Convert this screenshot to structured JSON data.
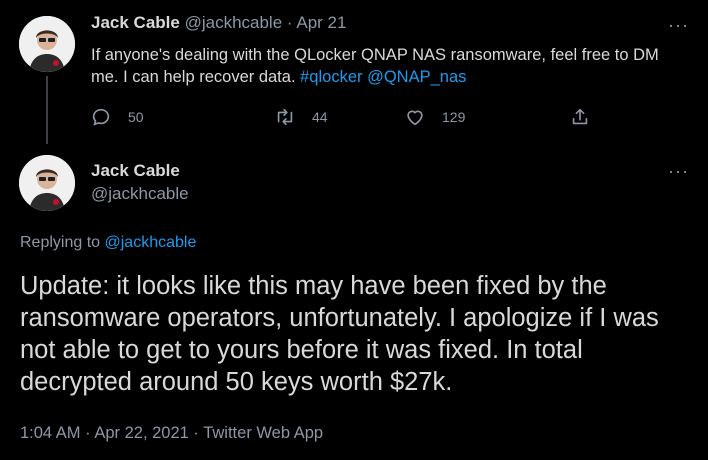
{
  "tweet1": {
    "name": "Jack Cable",
    "handle": "@jackhcable",
    "separator": "·",
    "date": "Apr 21",
    "text": "If anyone's dealing with the QLocker QNAP NAS ransomware, feel free to DM me. I can help recover data.",
    "hashtag": "#qlocker",
    "mention": "@QNAP_nas",
    "replies": "50",
    "retweets": "44",
    "likes": "129",
    "more_icon": "more-horizontal-icon"
  },
  "tweet2": {
    "name": "Jack Cable",
    "handle": "@jackhcable",
    "replying_label": "Replying to",
    "replying_to": "@jackhcable",
    "text": "Update: it looks like this may have been fixed by the ransomware operators, unfortunately. I apologize if I was not able to get to yours before it was fixed. In total decrypted around 50 keys worth $27k.",
    "time": "1:04 AM",
    "date": "Apr 22, 2021",
    "source": "Twitter Web App",
    "separator": "·"
  },
  "colors": {
    "background": "#000000",
    "text": "#d9d9d9",
    "muted": "#8b98a5",
    "link": "#1d9bf0"
  }
}
